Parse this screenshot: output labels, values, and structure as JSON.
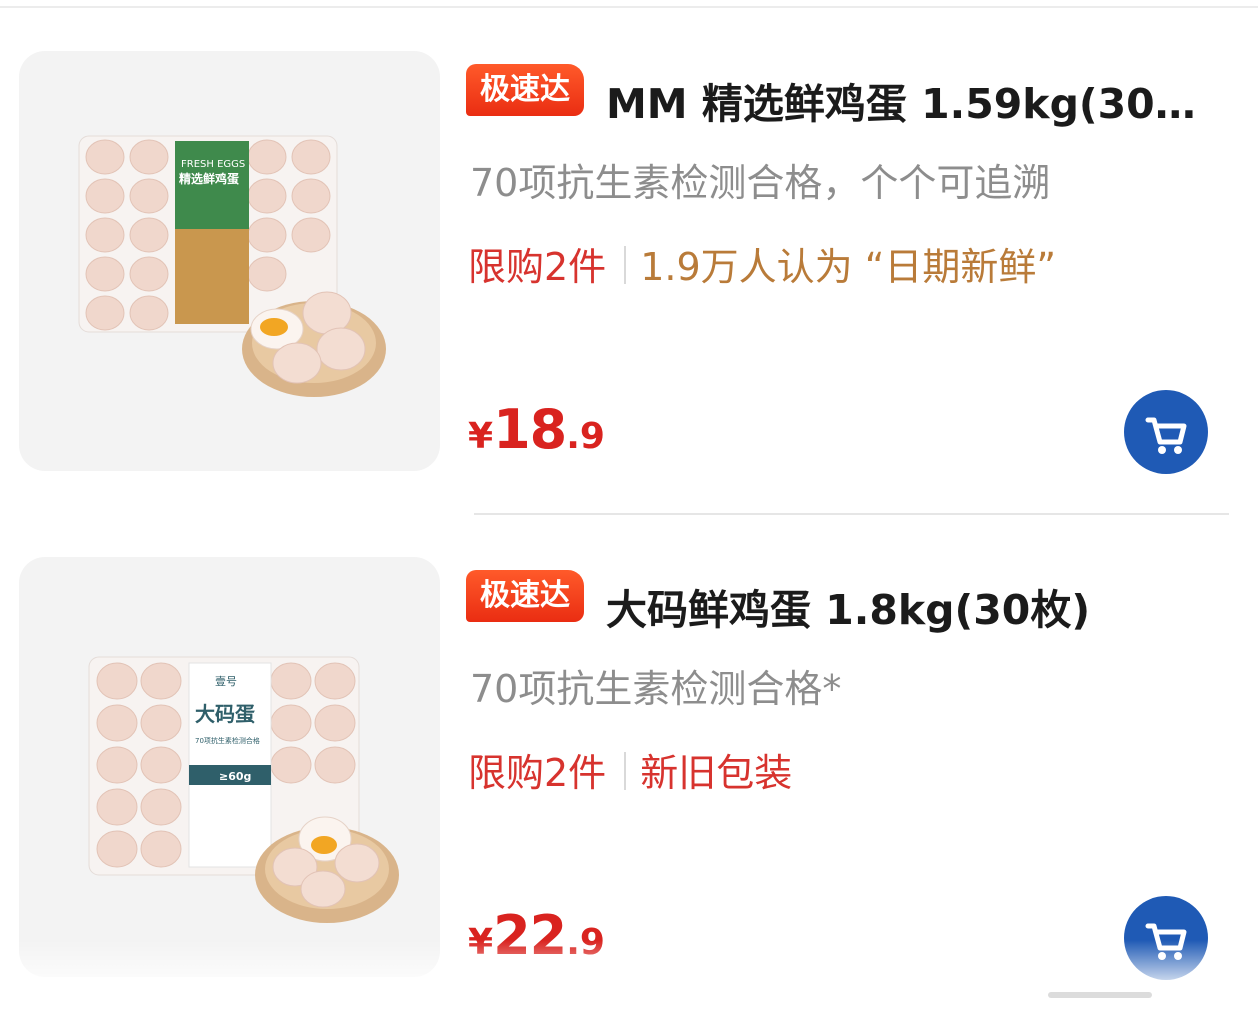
{
  "products": [
    {
      "badge": "极速达",
      "title": "MM 精选鲜鸡蛋 1.59kg(30…",
      "subtitle": "70项抗生素检测合格，个个可追溯",
      "limit": "限购2件",
      "info": "1.9万人认为 “日期新鲜”",
      "price": {
        "symbol": "¥",
        "integer": "18",
        "decimal": ".9"
      },
      "image_label": {
        "line1": "FRESH EGGS",
        "line2": "精选鲜鸡蛋"
      }
    },
    {
      "badge": "极速达",
      "title": "大码鲜鸡蛋 1.8kg(30枚)",
      "subtitle": "70项抗生素检测合格*",
      "limit": "限购2件",
      "info": "新旧包装",
      "price": {
        "symbol": "¥",
        "integer": "22",
        "decimal": ".9"
      },
      "image_label": {
        "line1": "壹号",
        "line2": "大码蛋",
        "line3": "70项抗生素检测合格",
        "line4": "≥60g"
      }
    }
  ],
  "icons": {
    "cart": "cart-icon"
  },
  "colors": {
    "badge": "#ea2d12",
    "price": "#d9231f",
    "cart": "#1f5ab5",
    "info_gold": "#b97b39"
  }
}
